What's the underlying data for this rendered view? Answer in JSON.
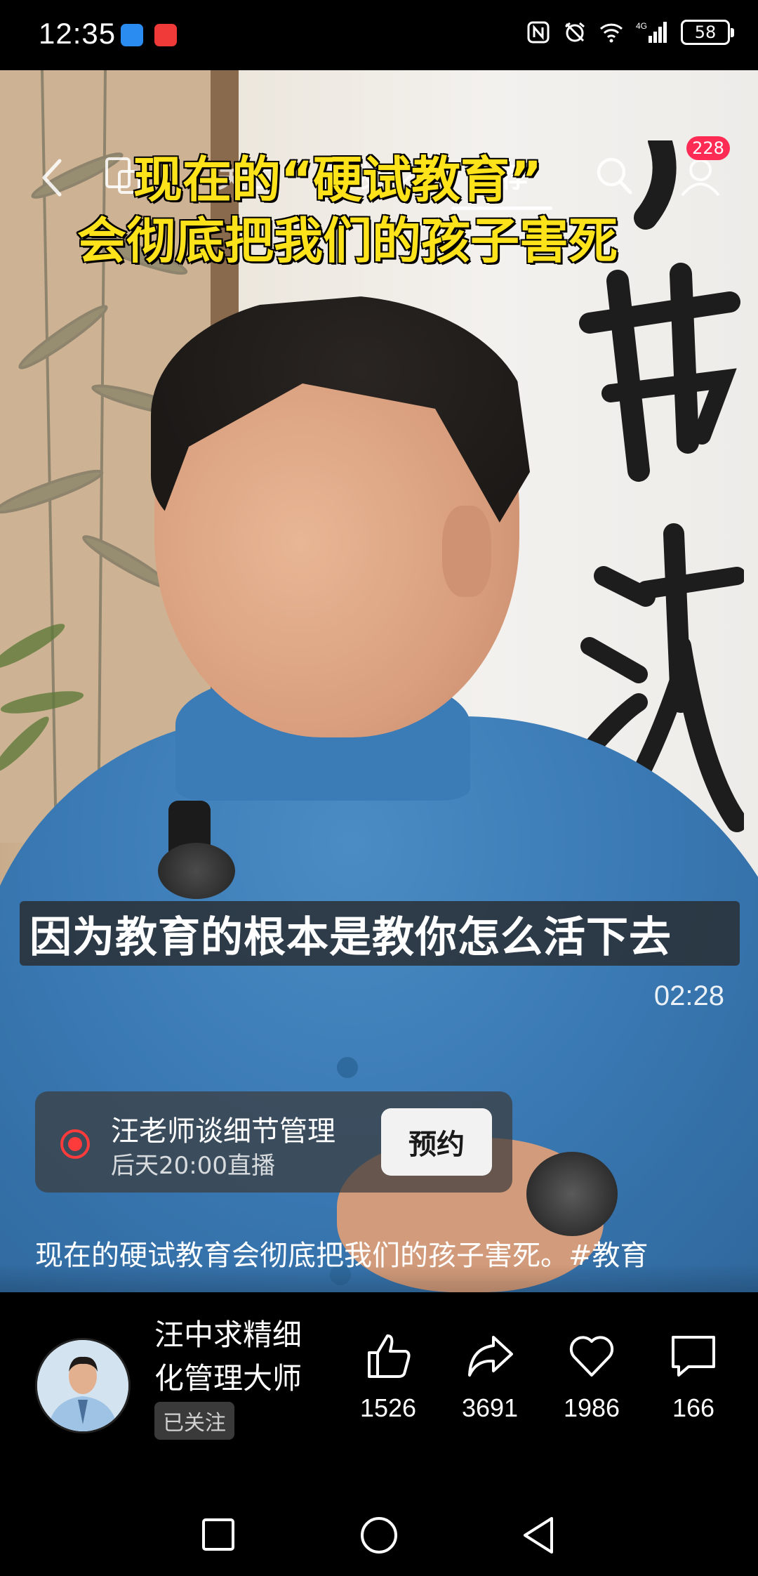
{
  "status_bar": {
    "time": "12:35",
    "battery": "58",
    "network": "4G"
  },
  "top_nav": {
    "tabs": [
      {
        "label": "关注"
      },
      {
        "label": "朋友"
      },
      {
        "label": "推荐"
      }
    ],
    "active_tab": "推荐",
    "notification_badge": "228",
    "icons": [
      "back-icon",
      "copy-icon",
      "heart-icon",
      "search-icon",
      "profile-icon"
    ]
  },
  "video": {
    "title_line1": "现在的“硬试教育”",
    "title_line2": "会彻底把我们的孩子害死",
    "subtitle": "因为教育的根本是教你怎么活下去",
    "duration": "02:28",
    "caption": "现在的硬试教育会彻底把我们的孩子害死。#教育"
  },
  "live_card": {
    "name": "汪老师谈细节管理",
    "time": "后天20:00直播",
    "button_label": "预约"
  },
  "author": {
    "name": "汪中求精细化管理大师",
    "follow_status": "已关注"
  },
  "actions": [
    {
      "icon": "thumbs-up-icon",
      "count": "1526"
    },
    {
      "icon": "share-icon",
      "count": "3691"
    },
    {
      "icon": "heart-icon",
      "count": "1986"
    },
    {
      "icon": "comment-icon",
      "count": "166"
    }
  ],
  "colors": {
    "accent": "#fe2c55",
    "title_yellow": "#ffe31a",
    "live_red": "#fe3b3b"
  }
}
